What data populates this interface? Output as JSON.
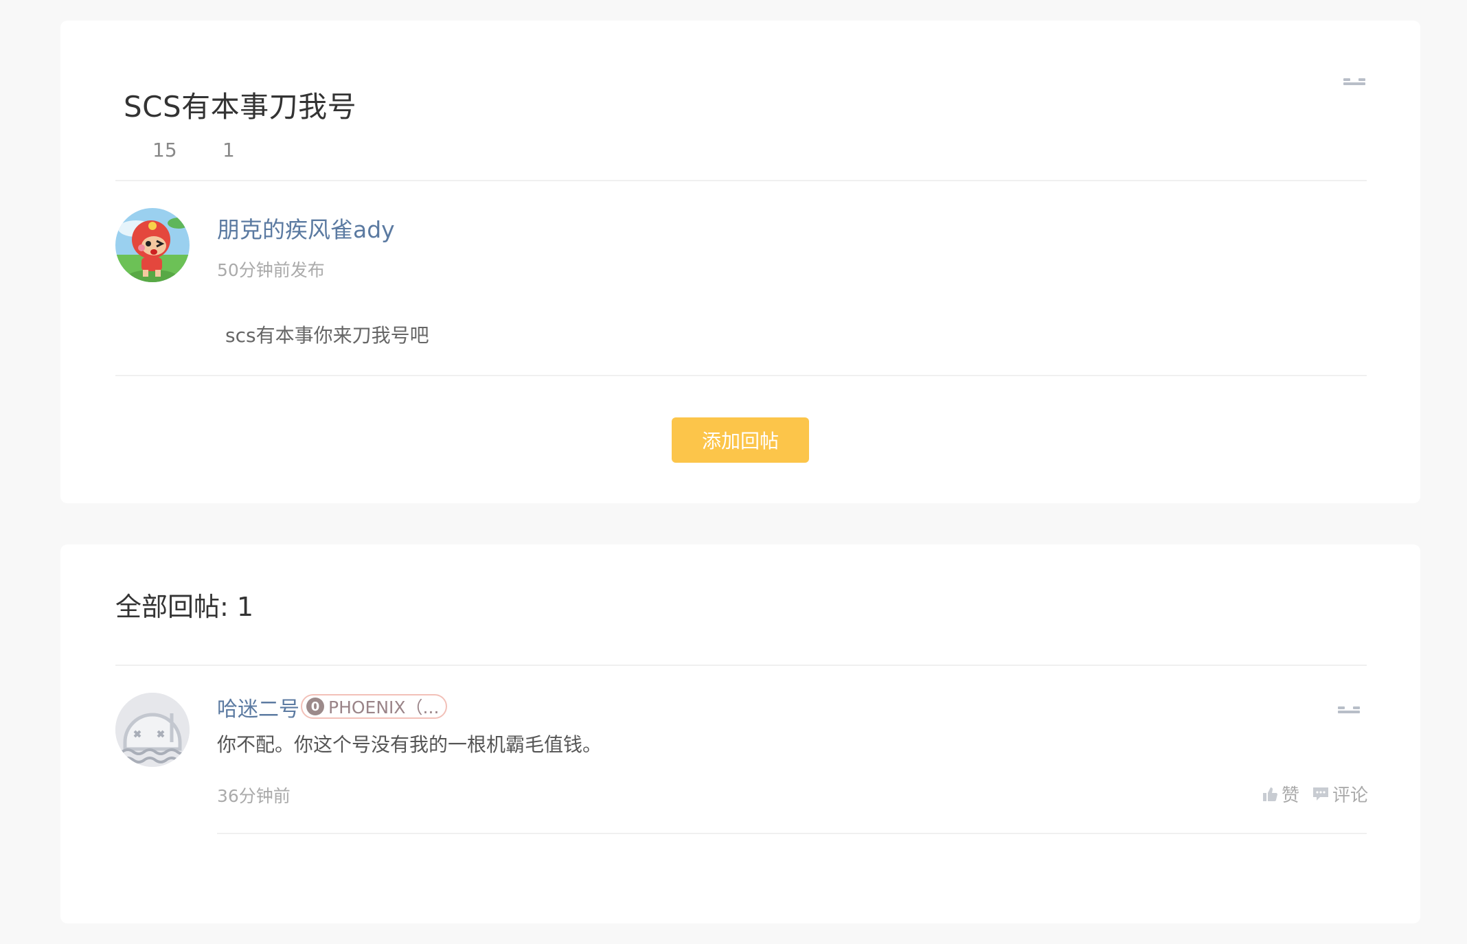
{
  "post": {
    "title": "SCS有本事刀我号",
    "stats": {
      "views": "15",
      "replies": "1"
    },
    "author": {
      "name": "朋克的疾风雀ady",
      "time": "50分钟前发布"
    },
    "content": "scs有本事你来刀我号吧",
    "add_reply_label": "添加回帖"
  },
  "replies": {
    "header": "全部回帖: 1",
    "items": [
      {
        "name": "哈迷二号",
        "badge": {
          "icon_text": "0",
          "text": "PHOENIX（..."
        },
        "content": "你不配。你这个号没有我的一根机霸毛值钱。",
        "time": "36分钟前",
        "like_label": "赞",
        "comment_label": "评论"
      }
    ]
  },
  "colors": {
    "accent": "#fcc54a",
    "link": "#5b7aa1"
  },
  "icons": {
    "menu": "more-icon",
    "like": "thumbs-up-icon",
    "comment": "comment-icon",
    "badge": "level-badge-icon"
  }
}
